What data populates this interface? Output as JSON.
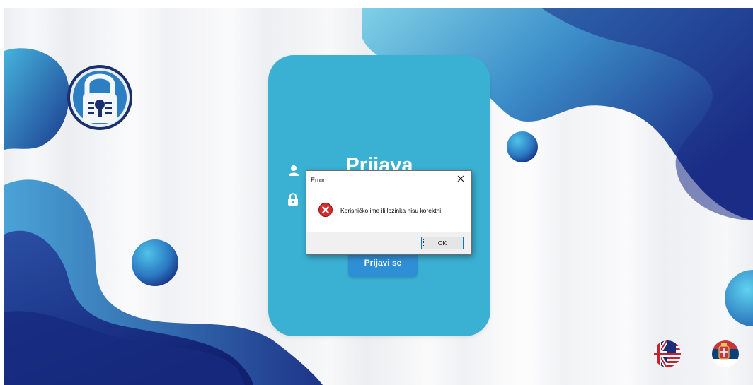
{
  "login": {
    "title": "Prijava",
    "submit_label": "Prijavi se"
  },
  "dialog": {
    "title": "Error",
    "message": "Korisničko ime ili lozinka nisu korektni!",
    "ok_label": "OK"
  },
  "icons": {
    "logo": "padlock-keyhole-logo-icon",
    "username": "user-icon",
    "password": "lock-icon",
    "error": "error-x-icon",
    "close": "close-icon",
    "english": "uk-us-flag-icon",
    "serbian": "serbia-flag-icon"
  },
  "colors": {
    "card": "#3ab1d3",
    "button": "#2f8fd6",
    "deco_dark": "#1c2f8a",
    "deco_light": "#3ab1d3",
    "error_red": "#d42c2c"
  }
}
